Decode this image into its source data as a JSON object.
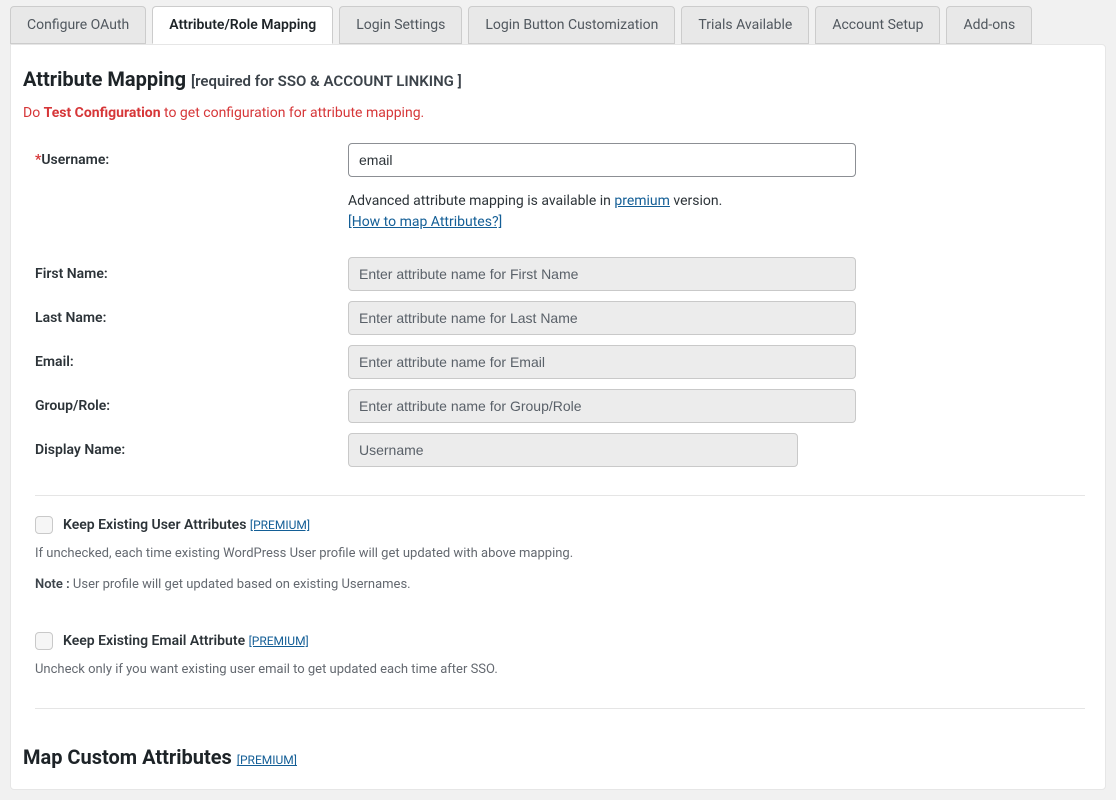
{
  "tabs": [
    {
      "label": "Configure OAuth",
      "active": false
    },
    {
      "label": "Attribute/Role Mapping",
      "active": true
    },
    {
      "label": "Login Settings",
      "active": false
    },
    {
      "label": "Login Button Customization",
      "active": false
    },
    {
      "label": "Trials Available",
      "active": false
    },
    {
      "label": "Account Setup",
      "active": false
    },
    {
      "label": "Add-ons",
      "active": false
    }
  ],
  "attrMapping": {
    "title": "Attribute Mapping",
    "subtitle": "[required for SSO & ACCOUNT LINKING ]",
    "redPrefix": "Do ",
    "redBold": "Test Configuration",
    "redSuffix": " to get configuration for attribute mapping.",
    "usernameLabel": "Username:",
    "usernameValue": "email",
    "advancedText1": "Advanced attribute mapping is available in ",
    "advancedLink": "premium",
    "advancedText2": " version.",
    "howToMap": "[How to map Attributes?]",
    "fields": {
      "firstName": {
        "label": "First Name:",
        "placeholder": "Enter attribute name for First Name"
      },
      "lastName": {
        "label": "Last Name:",
        "placeholder": "Enter attribute name for Last Name"
      },
      "email": {
        "label": "Email:",
        "placeholder": "Enter attribute name for Email"
      },
      "groupRole": {
        "label": "Group/Role:",
        "placeholder": "Enter attribute name for Group/Role"
      },
      "display": {
        "label": "Display Name:",
        "placeholder": "Username"
      }
    }
  },
  "premiumTag": "[PREMIUM]",
  "keepAttrs": {
    "label": "Keep Existing User Attributes",
    "hint": "If unchecked, each time existing WordPress User profile will get updated with above mapping.",
    "noteLabel": "Note :",
    "noteText": " User profile will get updated based on existing Usernames."
  },
  "keepEmail": {
    "label": "Keep Existing Email Attribute",
    "hint": "Uncheck only if you want existing user email to get updated each time after SSO."
  },
  "customAttrs": {
    "title": "Map Custom Attributes"
  }
}
